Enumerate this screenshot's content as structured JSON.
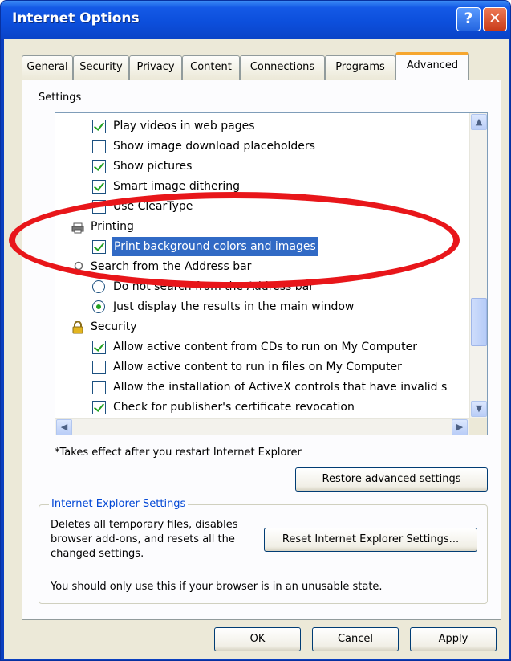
{
  "window": {
    "title": "Internet Options"
  },
  "tabs": [
    "General",
    "Security",
    "Privacy",
    "Content",
    "Connections",
    "Programs",
    "Advanced"
  ],
  "settings": {
    "label": "Settings",
    "rows": [
      {
        "kind": "checkbox",
        "checked": true,
        "label": "Play videos in web pages"
      },
      {
        "kind": "checkbox",
        "checked": false,
        "label": "Show image download placeholders"
      },
      {
        "kind": "checkbox",
        "checked": true,
        "label": "Show pictures"
      },
      {
        "kind": "checkbox",
        "checked": true,
        "label": "Smart image dithering"
      },
      {
        "kind": "checkbox",
        "checked": false,
        "label": "Use ClearType"
      },
      {
        "kind": "group",
        "icon": "printer-icon",
        "label": "Printing"
      },
      {
        "kind": "checkbox",
        "checked": true,
        "selected": true,
        "label": "Print background colors and images"
      },
      {
        "kind": "group",
        "icon": "search-icon",
        "label": "Search from the Address bar"
      },
      {
        "kind": "radio",
        "checked": false,
        "label": "Do not search from the Address bar"
      },
      {
        "kind": "radio",
        "checked": true,
        "label": "Just display the results in the main window"
      },
      {
        "kind": "group",
        "icon": "lock-icon",
        "label": "Security"
      },
      {
        "kind": "checkbox",
        "checked": true,
        "label": "Allow active content from CDs to run on My Computer"
      },
      {
        "kind": "checkbox",
        "checked": false,
        "label": "Allow active content to run in files on My Computer"
      },
      {
        "kind": "checkbox",
        "checked": false,
        "label": "Allow the installation of ActiveX controls that have invalid s"
      },
      {
        "kind": "checkbox",
        "checked": true,
        "label": "Check for publisher's certificate revocation"
      }
    ]
  },
  "restart_note": "*Takes effect after you restart Internet Explorer",
  "buttons": {
    "restore": "Restore advanced settings",
    "reset": "Reset Internet Explorer Settings...",
    "ok": "OK",
    "cancel": "Cancel",
    "apply": "Apply"
  },
  "ie_settings": {
    "title": "Internet Explorer Settings",
    "description": "Deletes all temporary files, disables browser add-ons, and resets all the changed settings.",
    "note": "You should only use this if your browser is in an unusable state."
  },
  "colors": {
    "annotation": "#e8161a",
    "selection": "#316ac5",
    "titlebar": "#0a43c7",
    "active_tab_accent": "#f6a62f"
  }
}
